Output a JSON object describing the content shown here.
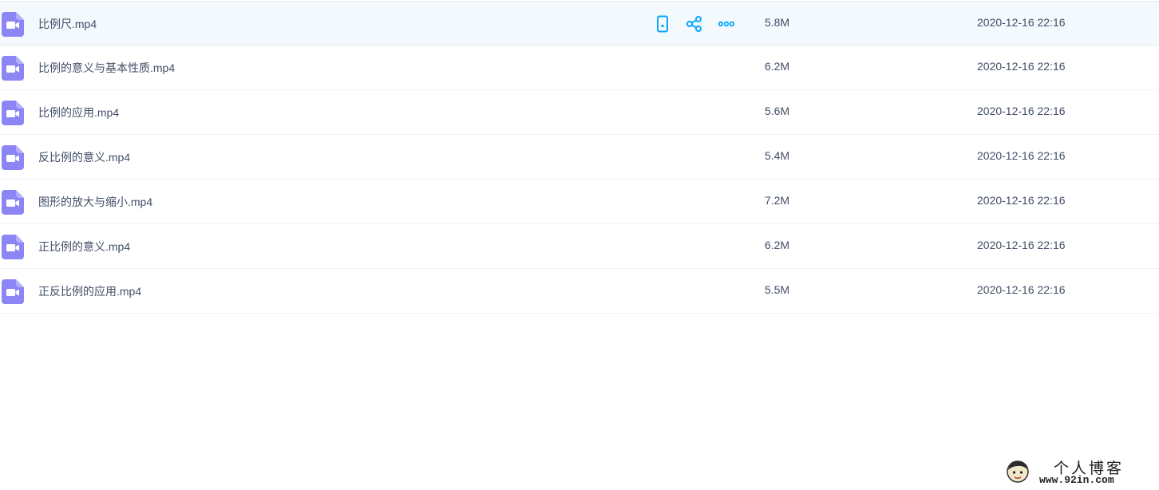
{
  "colors": {
    "accent": "#06a7ff",
    "video_icon": "#8b85f5",
    "hover_row": "#f3f9fd",
    "text": "#424e67"
  },
  "row_actions": [
    {
      "name": "send-to-phone-button",
      "icon": "phone-icon"
    },
    {
      "name": "share-button",
      "icon": "share-icon"
    },
    {
      "name": "more-button",
      "icon": "more-icon"
    }
  ],
  "files": [
    {
      "name": "比例尺.mp4",
      "size": "5.8M",
      "date": "2020-12-16 22:16",
      "icon": "video-file-icon"
    },
    {
      "name": "比例的意义与基本性质.mp4",
      "size": "6.2M",
      "date": "2020-12-16 22:16",
      "icon": "video-file-icon"
    },
    {
      "name": "比例的应用.mp4",
      "size": "5.6M",
      "date": "2020-12-16 22:16",
      "icon": "video-file-icon"
    },
    {
      "name": "反比例的意义.mp4",
      "size": "5.4M",
      "date": "2020-12-16 22:16",
      "icon": "video-file-icon"
    },
    {
      "name": "图形的放大与缩小.mp4",
      "size": "7.2M",
      "date": "2020-12-16 22:16",
      "icon": "video-file-icon"
    },
    {
      "name": "正比例的意义.mp4",
      "size": "6.2M",
      "date": "2020-12-16 22:16",
      "icon": "video-file-icon"
    },
    {
      "name": "正反比例的应用.mp4",
      "size": "5.5M",
      "date": "2020-12-16 22:16",
      "icon": "video-file-icon"
    }
  ],
  "watermark": {
    "title": "个人博客",
    "url": "www.92in.com"
  }
}
